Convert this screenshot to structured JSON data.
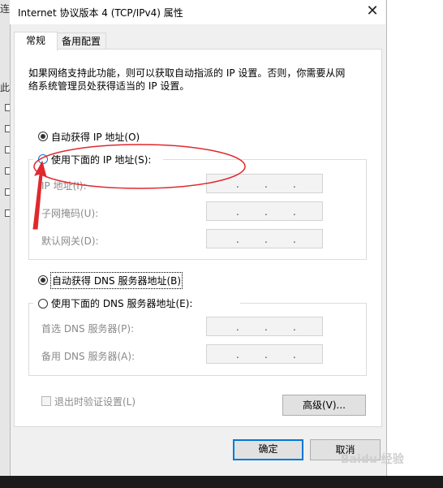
{
  "window": {
    "title": "Internet 协议版本 4 (TCP/IPv4) 属性",
    "close_glyph": "✕"
  },
  "background": {
    "side_chars": [
      "连",
      "此"
    ]
  },
  "tabs": [
    {
      "label": "常规"
    },
    {
      "label": "备用配置"
    }
  ],
  "general": {
    "description_line1": "如果网络支持此功能，则可以获取自动指派的 IP 设置。否则，你需要从网",
    "description_line2": "络系统管理员处获得适当的 IP 设置。",
    "ip": {
      "auto_label": "自动获得 IP 地址(O)",
      "auto_selected": true,
      "manual_label": "使用下面的 IP 地址(S):",
      "fields": [
        {
          "label": "IP 地址(I):",
          "value": ". . ."
        },
        {
          "label": "子网掩码(U):",
          "value": ". . ."
        },
        {
          "label": "默认网关(D):",
          "value": ". . ."
        }
      ]
    },
    "dns": {
      "auto_label": "自动获得 DNS 服务器地址(B)",
      "auto_selected": true,
      "manual_label": "使用下面的 DNS 服务器地址(E):",
      "fields": [
        {
          "label": "首选 DNS 服务器(P):",
          "value": ". . ."
        },
        {
          "label": "备用 DNS 服务器(A):",
          "value": ". . ."
        }
      ]
    },
    "validate_label": "退出时验证设置(L)",
    "validate_checked": false,
    "advanced_label": "高级(V)..."
  },
  "buttons": {
    "ok": "确定",
    "cancel": "取消"
  },
  "annotation": {
    "color": "#e0282e"
  },
  "watermark": {
    "text": "Baidu 经验"
  }
}
